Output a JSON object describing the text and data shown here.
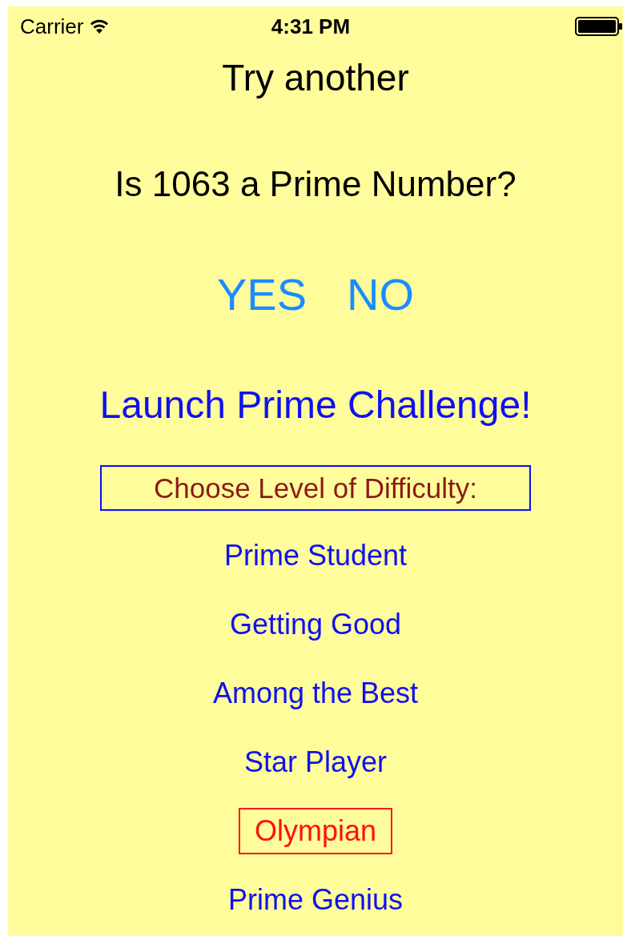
{
  "status_bar": {
    "carrier": "Carrier",
    "time": "4:31 PM"
  },
  "try_another": "Try another",
  "question": "Is 1063 a Prime Number?",
  "answers": [
    "YES",
    "NO"
  ],
  "launch_button": "Launch Prime Challenge!",
  "difficulty_label": "Choose Level of Difficulty:",
  "levels": [
    {
      "label": "Prime Student",
      "selected": false
    },
    {
      "label": "Getting Good",
      "selected": false
    },
    {
      "label": "Among the Best",
      "selected": false
    },
    {
      "label": "Star Player",
      "selected": false
    },
    {
      "label": "Olympian",
      "selected": true
    },
    {
      "label": "Prime Genius",
      "selected": false
    }
  ]
}
